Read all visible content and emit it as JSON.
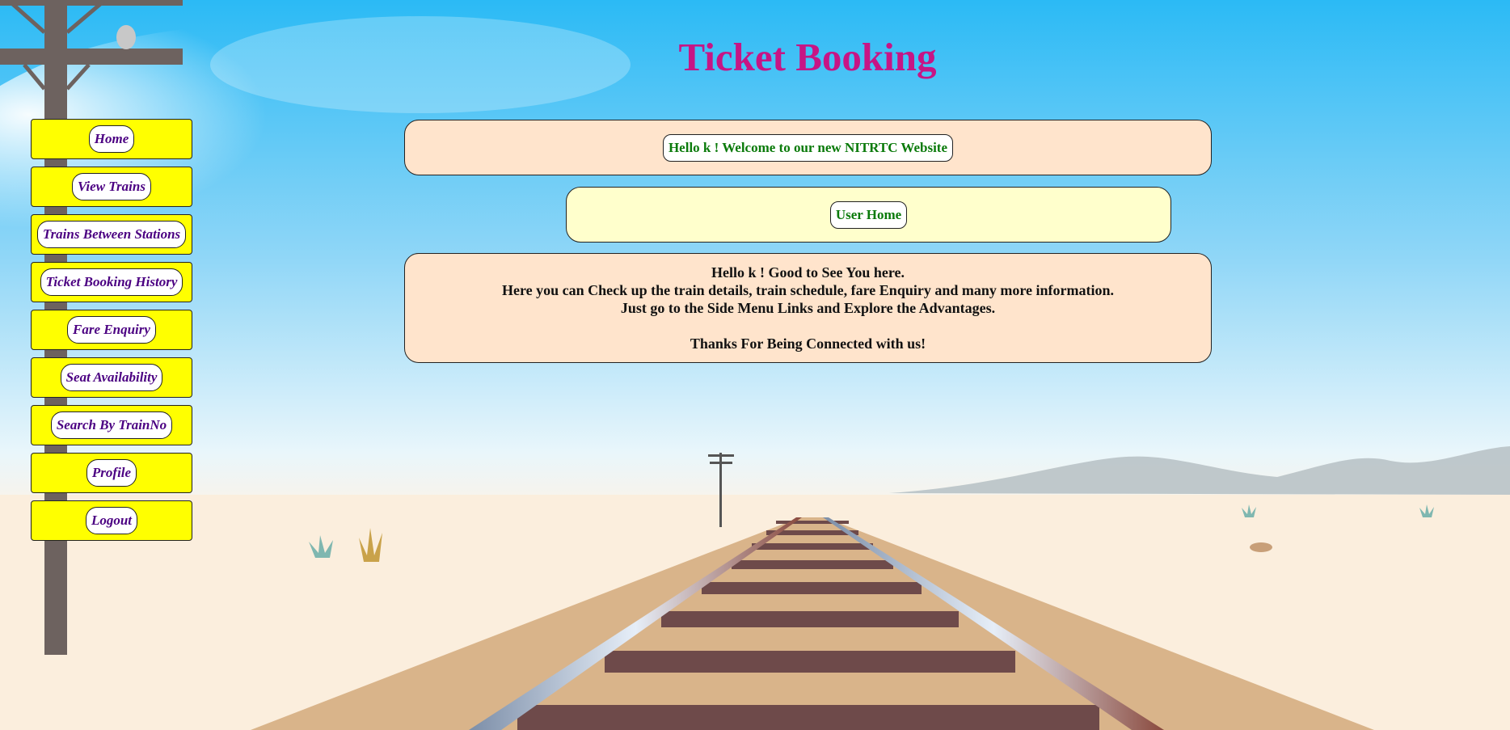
{
  "page": {
    "title": "Ticket Booking"
  },
  "sidebar": {
    "items": [
      {
        "label": "Home"
      },
      {
        "label": "View Trains"
      },
      {
        "label": "Trains Between Stations"
      },
      {
        "label": "Ticket Booking History"
      },
      {
        "label": "Fare Enquiry"
      },
      {
        "label": "Seat Availability"
      },
      {
        "label": "Search By TrainNo"
      },
      {
        "label": "Profile"
      },
      {
        "label": "Logout"
      }
    ]
  },
  "welcome": {
    "message": "Hello k ! Welcome to our new NITRTC Website"
  },
  "user_home": {
    "label": "User Home"
  },
  "info": {
    "line1": "Hello k ! Good to See You here.",
    "line2": "Here you can Check up the train details, train schedule, fare Enquiry and many more information.",
    "line3": "Just go to the Side Menu Links and Explore the Advantages.",
    "line4": "Thanks For Being Connected with us!"
  },
  "colors": {
    "title": "#c71585",
    "menu_bg": "#ffff00",
    "menu_text": "#4b0082",
    "welcome_text": "#0a7a0a",
    "box_peach": "#ffe4cc",
    "box_yellow": "#ffffcc"
  }
}
